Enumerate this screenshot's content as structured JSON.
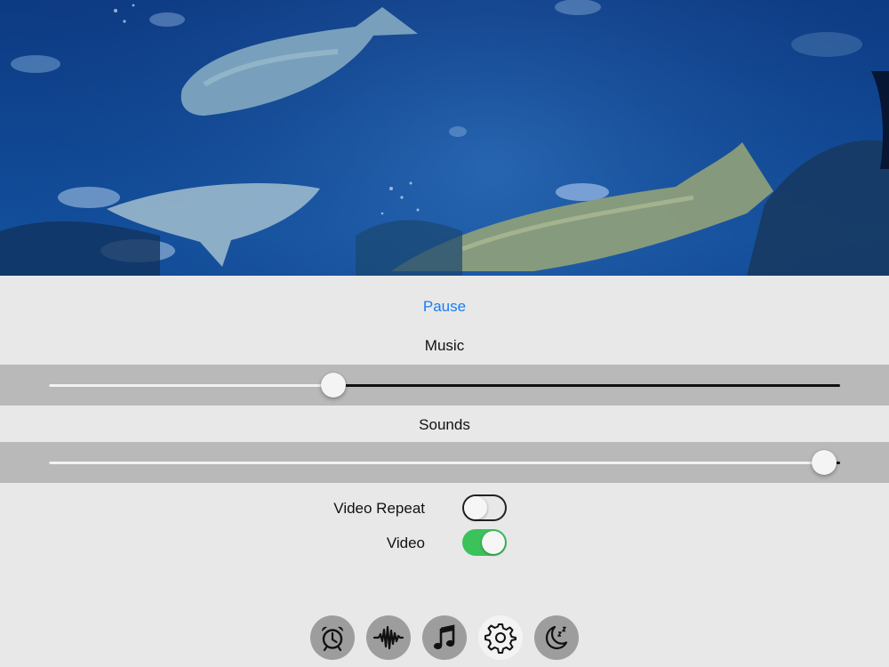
{
  "controls": {
    "pause_label": "Pause",
    "music": {
      "label": "Music",
      "value": 0.36
    },
    "sounds": {
      "label": "Sounds",
      "value": 0.98
    },
    "video_repeat": {
      "label": "Video Repeat",
      "on": false
    },
    "video": {
      "label": "Video",
      "on": true
    }
  },
  "tabbar": {
    "items": [
      {
        "icon": "alarm-clock-icon",
        "selected": false
      },
      {
        "icon": "waveform-icon",
        "selected": false
      },
      {
        "icon": "music-note-icon",
        "selected": false
      },
      {
        "icon": "gear-icon",
        "selected": true
      },
      {
        "icon": "sleep-moon-icon",
        "selected": false
      }
    ]
  },
  "colors": {
    "accent": "#1a7cf0",
    "switch_on": "#3cc25a",
    "water": "#0b2a5e"
  }
}
